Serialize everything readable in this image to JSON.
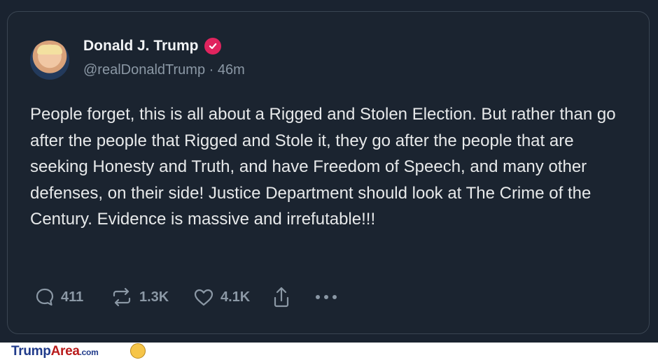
{
  "post": {
    "author_name": "Donald J. Trump",
    "handle": "@realDonaldTrump",
    "separator": "·",
    "time_ago": "46m",
    "text": "People forget, this is all about a Rigged and Stolen Election. But rather than go after the people that Rigged and Stole it, they go after the people that are seeking Honesty and Truth, and have Freedom of Speech, and many other defenses, on their side! Justice Department should look at The Crime of the Century. Evidence is massive and irrefutable!!!",
    "verified_badge_color": "#e0245e"
  },
  "actions": {
    "replies": {
      "icon": "reply-icon",
      "count": "411"
    },
    "retruths": {
      "icon": "repost-icon",
      "count": "1.3K"
    },
    "likes": {
      "icon": "heart-icon",
      "count": "4.1K"
    },
    "share": {
      "icon": "share-icon"
    },
    "more": {
      "icon": "more-icon"
    }
  },
  "watermark": {
    "brand_part1": "Trump",
    "brand_part2": "Area",
    "brand_suffix": ".com",
    "mascot_icon": "mascot-icon"
  }
}
